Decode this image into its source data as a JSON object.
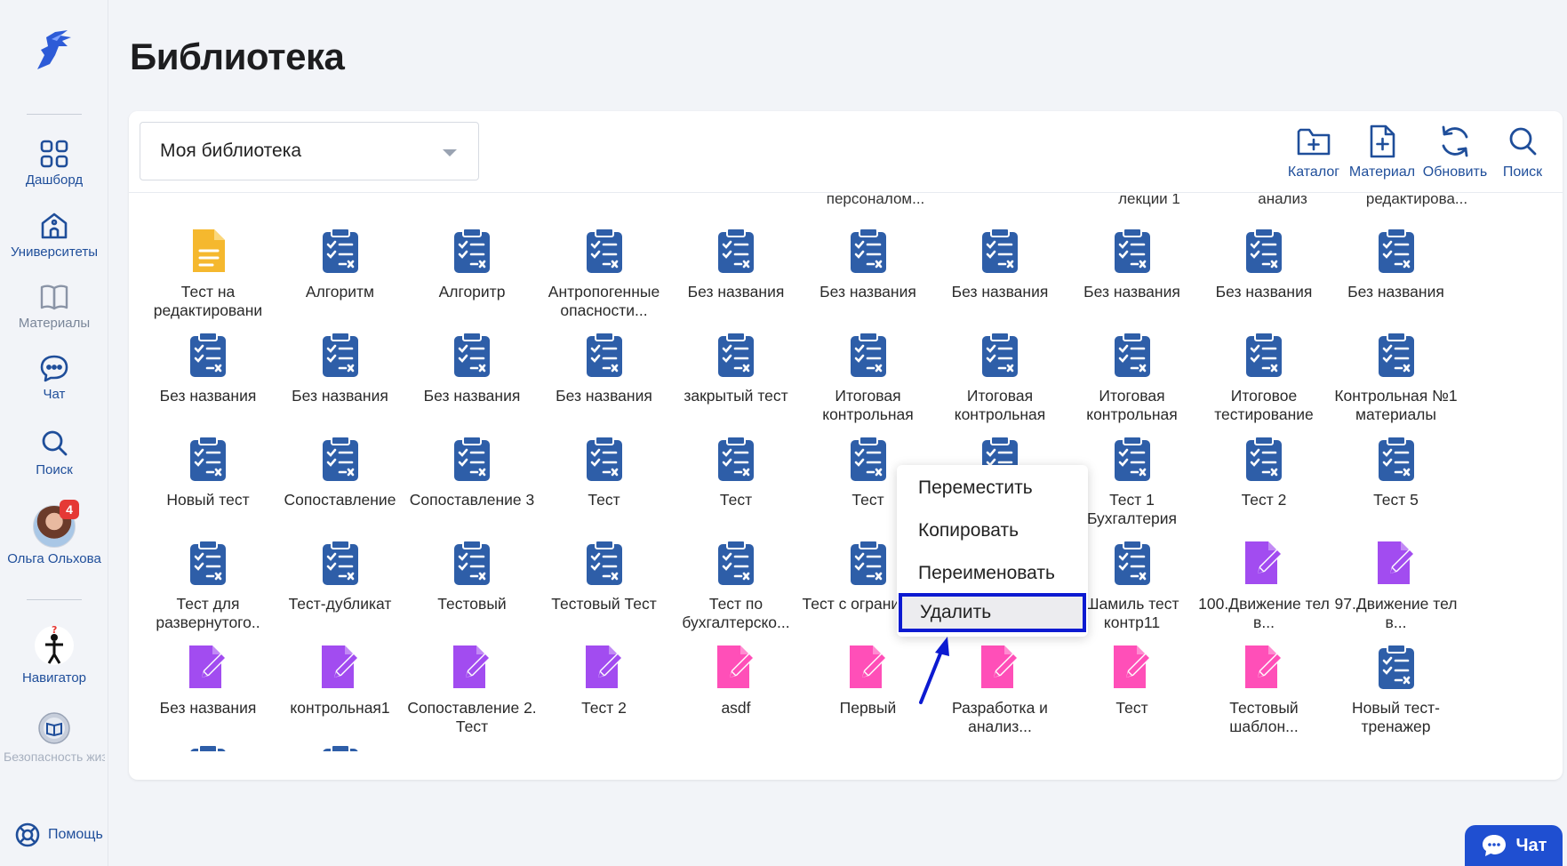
{
  "app": {
    "page_title": "Библиотека"
  },
  "sidebar": {
    "items": [
      {
        "label": "Дашборд",
        "icon": "grid-icon"
      },
      {
        "label": "Университеты",
        "icon": "university-icon"
      },
      {
        "label": "Материалы",
        "icon": "book-icon"
      },
      {
        "label": "Чат",
        "icon": "chat-icon"
      },
      {
        "label": "Поиск",
        "icon": "search-icon"
      }
    ],
    "user": {
      "name": "Ольга Ольхова",
      "badge": "4"
    },
    "navigator": {
      "label": "Навигатор"
    },
    "course": {
      "label": "Безопасность жизнедеятельн"
    },
    "help": {
      "label": "Помощь"
    }
  },
  "toolbar": {
    "library_select": "Моя библиотека",
    "buttons": [
      {
        "label": "Каталог",
        "icon": "folder-plus-icon"
      },
      {
        "label": "Материал",
        "icon": "file-plus-icon"
      },
      {
        "label": "Обновить",
        "icon": "refresh-icon"
      },
      {
        "label": "Поиск",
        "icon": "search-icon"
      }
    ]
  },
  "grid": {
    "partial_row": [
      "персоналом...",
      "лекции 1",
      "анализ",
      "редактирова..."
    ],
    "rows": [
      [
        {
          "label": "Тест на редактировани",
          "type": "doc"
        },
        {
          "label": "Алгоритм",
          "type": "test"
        },
        {
          "label": "Алгоритр",
          "type": "test"
        },
        {
          "label": "Антропогенные опасности...",
          "type": "test"
        },
        {
          "label": "Без названия",
          "type": "test"
        },
        {
          "label": "Без названия",
          "type": "test"
        },
        {
          "label": "Без названия",
          "type": "test"
        },
        {
          "label": "Без названия",
          "type": "test"
        },
        {
          "label": "Без названия",
          "type": "test"
        },
        {
          "label": "Без названия",
          "type": "test"
        }
      ],
      [
        {
          "label": "Без названия",
          "type": "test"
        },
        {
          "label": "Без названия",
          "type": "test"
        },
        {
          "label": "Без названия",
          "type": "test"
        },
        {
          "label": "Без названия",
          "type": "test"
        },
        {
          "label": "закрытый тест",
          "type": "test"
        },
        {
          "label": "Итоговая контрольная",
          "type": "test"
        },
        {
          "label": "Итоговая контрольная",
          "type": "test"
        },
        {
          "label": "Итоговая контрольная",
          "type": "test"
        },
        {
          "label": "Итоговое тестирование",
          "type": "test"
        },
        {
          "label": "Контрольная №1 материалы",
          "type": "test"
        }
      ],
      [
        {
          "label": "Новый тест",
          "type": "test"
        },
        {
          "label": "Сопоставление",
          "type": "test"
        },
        {
          "label": "Сопоставление 3",
          "type": "test"
        },
        {
          "label": "Тест",
          "type": "test"
        },
        {
          "label": "Тест",
          "type": "test"
        },
        {
          "label": "Тест",
          "type": "test"
        },
        {
          "label": "",
          "type": "test"
        },
        {
          "label": "Тест 1 Бухгалтерия",
          "type": "test"
        },
        {
          "label": "Тест 2",
          "type": "test"
        },
        {
          "label": "Тест 5",
          "type": "test"
        }
      ],
      [
        {
          "label": "Тест для развернутого..",
          "type": "test"
        },
        {
          "label": "Тест-дубликат",
          "type": "test"
        },
        {
          "label": "Тестовый",
          "type": "test"
        },
        {
          "label": "Тестовый Тест",
          "type": "test"
        },
        {
          "label": "Тест по бухгалтерско...",
          "type": "test"
        },
        {
          "label": "Тест с ограничени",
          "type": "test"
        },
        {
          "label": "",
          "type": "test"
        },
        {
          "label": "Шамиль тест контр11",
          "type": "test"
        },
        {
          "label": "100.Движение тел в...",
          "type": "task-purple"
        },
        {
          "label": "97.Движение тел в...",
          "type": "task-purple"
        }
      ],
      [
        {
          "label": "Без названия",
          "type": "task-purple"
        },
        {
          "label": "контрольная1",
          "type": "task-purple"
        },
        {
          "label": "Сопоставление 2. Тест",
          "type": "task-purple"
        },
        {
          "label": "Тест 2",
          "type": "task-purple"
        },
        {
          "label": "asdf",
          "type": "task-pink"
        },
        {
          "label": "Первый",
          "type": "task-pink"
        },
        {
          "label": "Разработка и анализ...",
          "type": "task-pink"
        },
        {
          "label": "Тест",
          "type": "task-pink"
        },
        {
          "label": "Тестовый шаблон...",
          "type": "task-pink"
        },
        {
          "label": "Новый тест-тренажер",
          "type": "test"
        }
      ]
    ]
  },
  "context_menu": {
    "items": [
      "Переместить",
      "Копировать",
      "Переименовать",
      "Удалить"
    ],
    "selected": "Удалить"
  },
  "chat_button": {
    "label": "Чат"
  },
  "colors": {
    "accent": "#1f4e9a",
    "test_icon": "#2e5ea8",
    "doc_icon": "#f5b82e",
    "task_purple": "#a24cf0",
    "task_pink": "#ff4fb8",
    "highlight_border": "#0c1ad1",
    "chat_button": "#1f4fd1"
  }
}
